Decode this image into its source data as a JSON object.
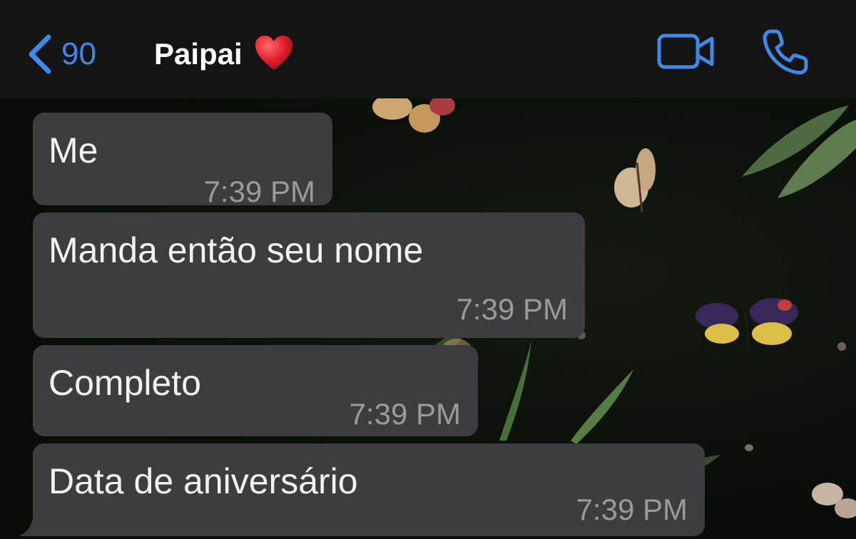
{
  "header": {
    "back_count": "90",
    "contact_name": "Paipai",
    "heart_icon": "red-heart-icon",
    "video_icon": "video-camera-icon",
    "call_icon": "phone-icon",
    "accent_color": "#3f8ae6"
  },
  "messages": [
    {
      "text": "Me",
      "time": "7:39 PM"
    },
    {
      "text": "Manda então seu nome",
      "time": "7:39 PM"
    },
    {
      "text": "Completo",
      "time": "7:39 PM"
    },
    {
      "text": "Data de aniversário",
      "time": "7:39 PM"
    }
  ],
  "colors": {
    "bubble": "#3d3d40",
    "header_bg": "#141414",
    "time_text": "#9a9a9e"
  }
}
